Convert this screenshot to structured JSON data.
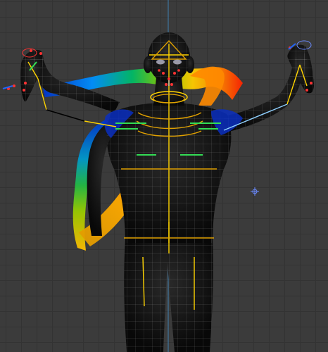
{
  "viewport": {
    "view": "front-orthographic",
    "grid": true,
    "background_color": "#3b3b3b",
    "grid_color": "#333333",
    "axis_color": "#3f7fb0"
  },
  "scene": {
    "object": "character-mesh",
    "display": "wireframe-on-shaded",
    "mesh_color": "#111111",
    "wire_color": "#d9d9d9",
    "rig": {
      "bone_color": "#ffd400",
      "control_color": "#33dd55",
      "joint_color": "#e0a000",
      "ik_line_color": "#000000"
    },
    "weight_ribbon": {
      "gradient": [
        "#0033cc",
        "#00a0ff",
        "#00cc66",
        "#88cc00",
        "#ffcc00",
        "#ff8800",
        "#ff2200"
      ]
    },
    "handles": {
      "color": "#ff3333"
    }
  },
  "scene_cursor": {
    "icon": "3d-cursor-icon",
    "color": "#6a8aff"
  }
}
